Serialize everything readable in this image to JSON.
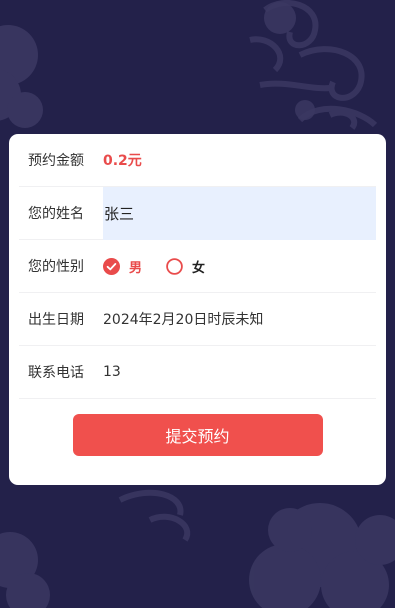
{
  "form": {
    "amount_label": "预约金额",
    "amount_value": "0.2元",
    "name_label": "您的姓名",
    "name_value": "张三",
    "gender_label": "您的性别",
    "gender_options": [
      "男",
      "女"
    ],
    "gender_selected": "男",
    "birth_label": "出生日期",
    "birth_value": "2024年2月20日时辰未知",
    "phone_label": "联系电话",
    "phone_value": "13",
    "submit_label": "提交预约"
  },
  "colors": {
    "background": "#23214a",
    "accent": "#e94b4b",
    "button": "#f0504d",
    "input_highlight": "#e8f0fe"
  },
  "icons": {
    "radio_checked": "checked-radio-icon",
    "radio_unchecked": "unchecked-radio-icon",
    "background": "cloud-pattern"
  }
}
